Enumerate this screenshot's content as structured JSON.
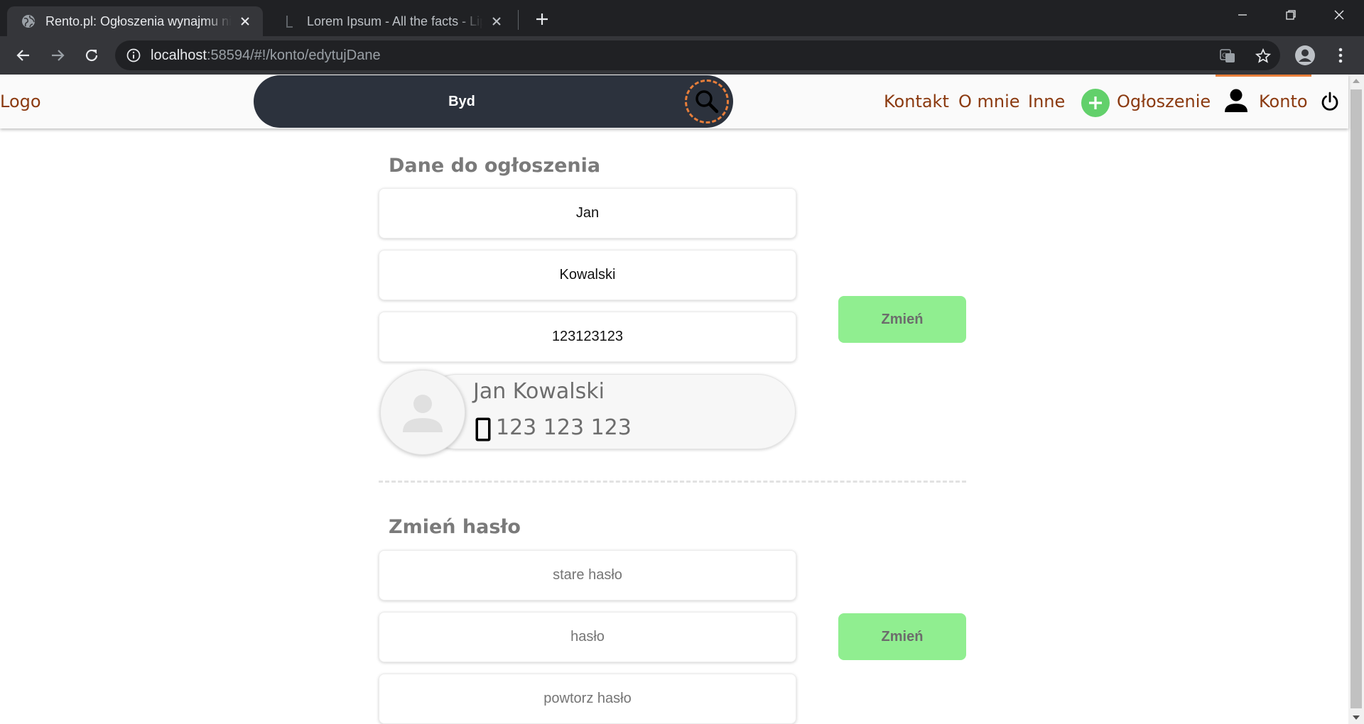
{
  "browser": {
    "tabs": [
      {
        "title": "Rento.pl: Ogłoszenia wynajmu nieruchomości",
        "active": true
      },
      {
        "title": "Lorem Ipsum - All the facts - Lipsum generator",
        "active": false
      }
    ],
    "url_host": "localhost",
    "url_rest": ":58594/#!/konto/edytujDane"
  },
  "header": {
    "logo": "Logo",
    "search_value": "Byd",
    "nav": {
      "kontakt": "Kontakt",
      "o_mnie": "O mnie",
      "inne": "Inne",
      "ogloszenie": "Ogłoszenie",
      "konto": "Konto"
    }
  },
  "ad_data": {
    "title": "Dane do ogłoszenia",
    "first_name": "Jan",
    "last_name": "Kowalski",
    "phone": "123123123",
    "submit_label": "Zmień",
    "preview": {
      "name": "Jan Kowalski",
      "phone": "123 123 123"
    }
  },
  "password": {
    "title": "Zmień hasło",
    "old_placeholder": "stare hasło",
    "new_placeholder": "hasło",
    "repeat_placeholder": "powtorz hasło",
    "submit_label": "Zmień"
  },
  "colors": {
    "brand_link": "#8b3a10",
    "accent_orange": "#e87e3a",
    "button_green": "#90ee90",
    "plus_green": "#62d06b",
    "search_bg": "#2c323d"
  }
}
